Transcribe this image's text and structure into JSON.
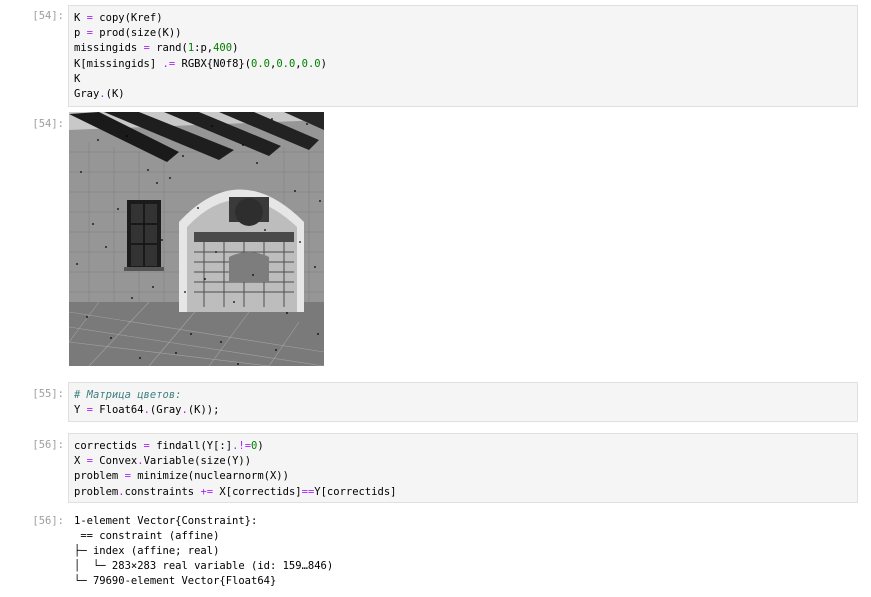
{
  "cells": [
    {
      "prompt": "[54]:",
      "code": [
        [
          {
            "t": "K "
          },
          {
            "t": "=",
            "c": "op"
          },
          {
            "t": " copy(Kref)"
          }
        ],
        [
          {
            "t": "p "
          },
          {
            "t": "=",
            "c": "op"
          },
          {
            "t": " prod(size(K))"
          }
        ],
        [
          {
            "t": "missingids "
          },
          {
            "t": "=",
            "c": "op"
          },
          {
            "t": " rand("
          },
          {
            "t": "1",
            "c": "num"
          },
          {
            "t": ":p,"
          },
          {
            "t": "400",
            "c": "num"
          },
          {
            "t": ")"
          }
        ],
        [
          {
            "t": "K[missingids] "
          },
          {
            "t": ".=",
            "c": "op"
          },
          {
            "t": " RGBX{N0f8}("
          },
          {
            "t": "0.0",
            "c": "num"
          },
          {
            "t": ","
          },
          {
            "t": "0.0",
            "c": "num"
          },
          {
            "t": ","
          },
          {
            "t": "0.0",
            "c": "num"
          },
          {
            "t": ")"
          }
        ],
        [
          {
            "t": "K"
          }
        ],
        [
          {
            "t": "Gray"
          },
          {
            "t": ".",
            "c": "op"
          },
          {
            "t": "(K)"
          }
        ]
      ],
      "output_prompt": "[54]:",
      "output_image": "grayscale image"
    },
    {
      "prompt": "[55]:",
      "code": [
        [
          {
            "t": "# Матрица цветов:",
            "c": "cm"
          }
        ],
        [
          {
            "t": "Y "
          },
          {
            "t": "=",
            "c": "op"
          },
          {
            "t": " Float64"
          },
          {
            "t": ".",
            "c": "op"
          },
          {
            "t": "(Gray"
          },
          {
            "t": ".",
            "c": "op"
          },
          {
            "t": "(K));"
          }
        ]
      ]
    },
    {
      "prompt": "[56]:",
      "code": [
        [
          {
            "t": "correctids "
          },
          {
            "t": "=",
            "c": "op"
          },
          {
            "t": " findall(Y[:]"
          },
          {
            "t": ".!=",
            "c": "op"
          },
          {
            "t": "0",
            "c": "num"
          },
          {
            "t": ")"
          }
        ],
        [
          {
            "t": "X "
          },
          {
            "t": "=",
            "c": "op"
          },
          {
            "t": " Convex"
          },
          {
            "t": ".",
            "c": "op"
          },
          {
            "t": "Variable(size(Y))"
          }
        ],
        [
          {
            "t": "problem "
          },
          {
            "t": "=",
            "c": "op"
          },
          {
            "t": " minimize(nuclearnorm(X))"
          }
        ],
        [
          {
            "t": "problem"
          },
          {
            "t": ".",
            "c": "op"
          },
          {
            "t": "constraints "
          },
          {
            "t": "+=",
            "c": "op"
          },
          {
            "t": " X[correctids]"
          },
          {
            "t": "==",
            "c": "op"
          },
          {
            "t": "Y[correctids]"
          }
        ]
      ],
      "output_prompt": "[56]:",
      "output_text": [
        "1-element Vector{Constraint}:",
        " == constraint (affine)",
        "├─ index (affine; real)",
        "│  └─ 283×283 real variable (id: 159…846)",
        "└─ 79690-element Vector{Float64}"
      ]
    }
  ]
}
